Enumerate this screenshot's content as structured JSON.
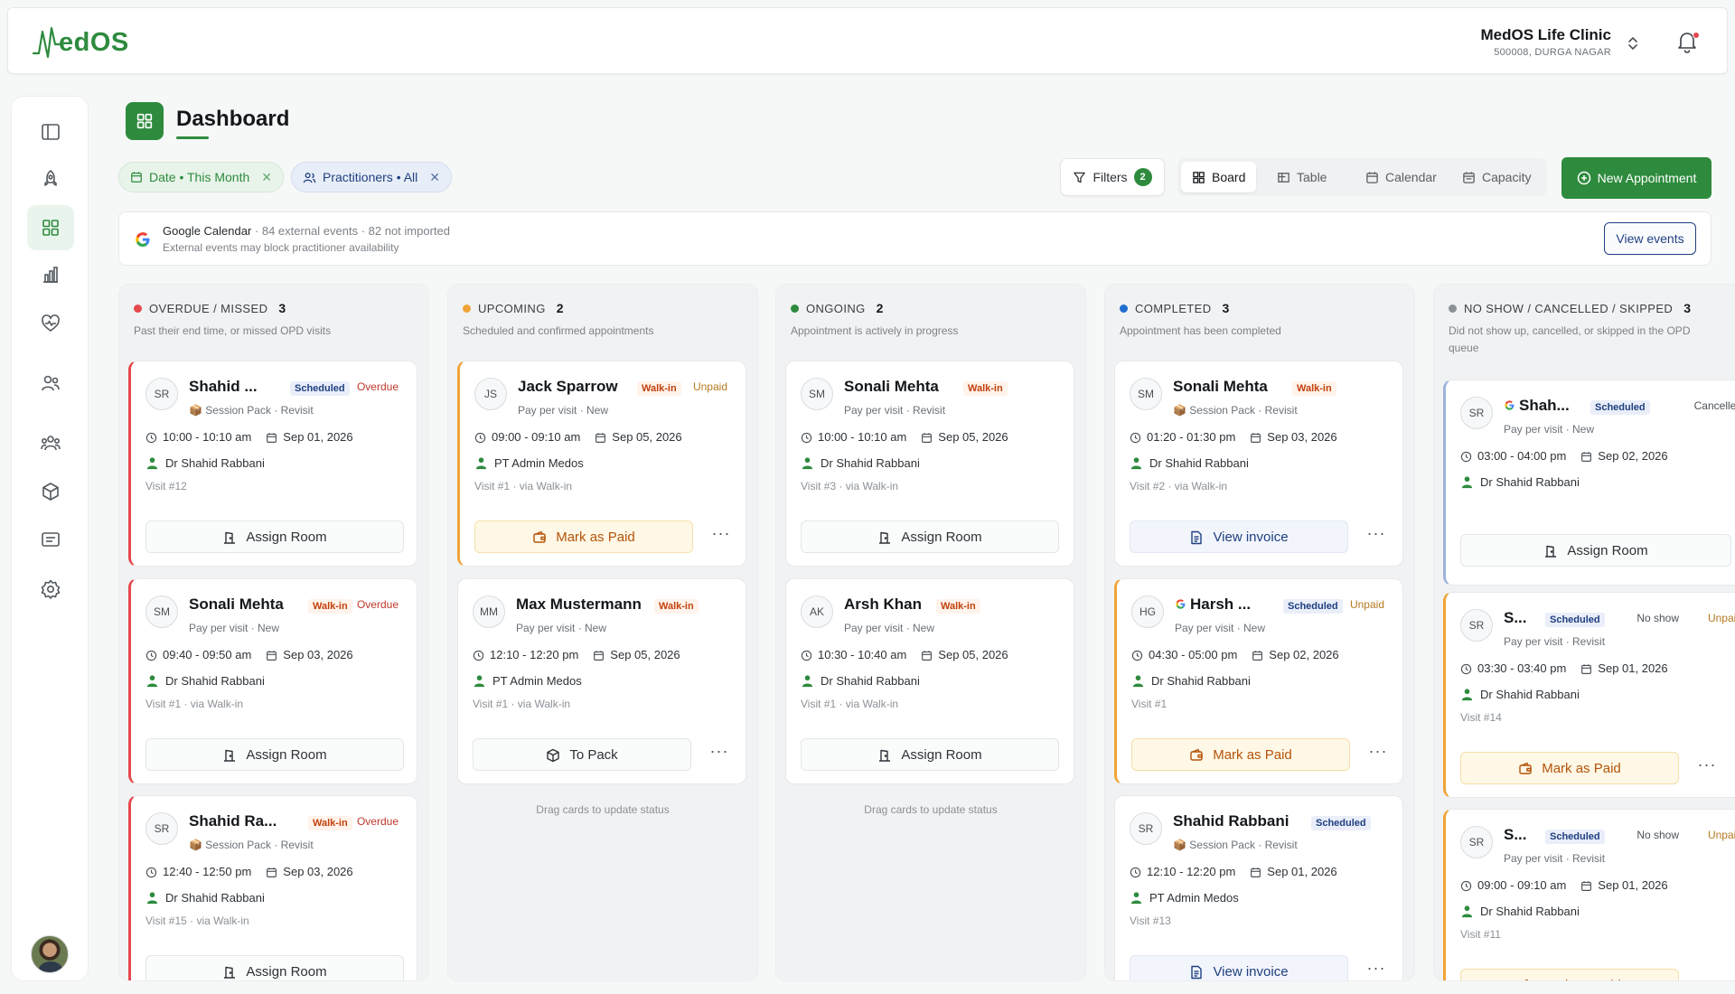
{
  "brand": {
    "logo_text": "edOS",
    "accent": "#2e8b3e"
  },
  "clinic": {
    "name": "MedOS Life Clinic",
    "address": "500008, DURGA NAGAR"
  },
  "page": {
    "title": "Dashboard"
  },
  "filter_chips": [
    {
      "label": "Date • This Month"
    },
    {
      "label": "Practitioners • All"
    }
  ],
  "toolbar": {
    "filters_label": "Filters",
    "filters_count": "2",
    "views": [
      "Board",
      "Table",
      "Calendar",
      "Capacity"
    ],
    "active_view": "Board",
    "new_appointment": "New Appointment"
  },
  "gcal": {
    "title": "Google Calendar",
    "meta": " · 84 external events · 82 not imported",
    "subtitle": "External events may block practitioner availability",
    "button": "View events"
  },
  "columns": [
    {
      "title": "OVERDUE / MISSED",
      "count": "3",
      "color": "#e5484d",
      "subtitle": "Past their end time, or missed OPD visits",
      "hint": "",
      "cards": [
        {
          "initials": "SR",
          "name": "Shahid ...",
          "tag": "Scheduled",
          "tag_type": "scheduled",
          "status": "Overdue",
          "status_type": "overdue",
          "pkg": "📦 Session Pack · Revisit",
          "time": "10:00 - 10:10 am",
          "date": "Sep 01, 2026",
          "doctor": "Dr Shahid Rabbani",
          "visit": "Visit #12",
          "action": "Assign Room",
          "action_type": "room",
          "more": false
        },
        {
          "initials": "SM",
          "name": "Sonali Mehta",
          "tag": "Walk-in",
          "tag_type": "walkin",
          "status": "Overdue",
          "status_type": "overdue",
          "pkg": "Pay per visit · New",
          "time": "09:40 - 09:50 am",
          "date": "Sep 03, 2026",
          "doctor": "Dr Shahid Rabbani",
          "visit": "Visit #1 · via Walk-in",
          "action": "Assign Room",
          "action_type": "room",
          "more": false
        },
        {
          "initials": "SR",
          "name": "Shahid Ra...",
          "tag": "Walk-in",
          "tag_type": "walkin",
          "status": "Overdue",
          "status_type": "overdue",
          "pkg": "📦 Session Pack · Revisit",
          "time": "12:40 - 12:50 pm",
          "date": "Sep 03, 2026",
          "doctor": "Dr Shahid Rabbani",
          "visit": "Visit #15 · via Walk-in",
          "action": "Assign Room",
          "action_type": "room",
          "more": false
        }
      ]
    },
    {
      "title": "UPCOMING",
      "count": "2",
      "color": "#f0a437",
      "subtitle": "Scheduled and confirmed appointments",
      "hint": "Drag cards to update status",
      "cards": [
        {
          "initials": "JS",
          "name": "Jack Sparrow",
          "tag": "Walk-in",
          "tag_type": "walkin",
          "status": "Unpaid",
          "status_type": "unpaid",
          "pkg": "Pay per visit · New",
          "time": "09:00 - 09:10 am",
          "date": "Sep 05, 2026",
          "doctor": "PT Admin Medos",
          "visit": "Visit #1 · via Walk-in",
          "action": "Mark as Paid",
          "action_type": "paid",
          "more": true
        },
        {
          "initials": "MM",
          "name": "Max Mustermann",
          "tag": "Walk-in",
          "tag_type": "walkin",
          "status": "",
          "status_type": "",
          "pkg": "Pay per visit · New",
          "time": "12:10 - 12:20 pm",
          "date": "Sep 05, 2026",
          "doctor": "PT Admin Medos",
          "visit": "Visit #1 · via Walk-in",
          "action": "To Pack",
          "action_type": "pack",
          "more": true
        }
      ]
    },
    {
      "title": "ONGOING",
      "count": "2",
      "color": "#2e8b3e",
      "subtitle": "Appointment is actively in progress",
      "hint": "Drag cards to update status",
      "cards": [
        {
          "initials": "SM",
          "name": "Sonali Mehta",
          "tag": "Walk-in",
          "tag_type": "walkin",
          "status": "",
          "status_type": "",
          "pkg": "Pay per visit · Revisit",
          "time": "10:00 - 10:10 am",
          "date": "Sep 05, 2026",
          "doctor": "Dr Shahid Rabbani",
          "visit": "Visit #3 · via Walk-in",
          "action": "Assign Room",
          "action_type": "room",
          "more": false
        },
        {
          "initials": "AK",
          "name": "Arsh Khan",
          "tag": "Walk-in",
          "tag_type": "walkin",
          "status": "",
          "status_type": "",
          "pkg": "Pay per visit · New",
          "time": "10:30 - 10:40 am",
          "date": "Sep 05, 2026",
          "doctor": "Dr Shahid Rabbani",
          "visit": "Visit #1 · via Walk-in",
          "action": "Assign Room",
          "action_type": "room",
          "more": false
        }
      ]
    },
    {
      "title": "COMPLETED",
      "count": "3",
      "color": "#1f6fd1",
      "subtitle": "Appointment has been completed",
      "hint": "",
      "cards": [
        {
          "initials": "SM",
          "name": "Sonali Mehta",
          "tag": "Walk-in",
          "tag_type": "walkin",
          "status": "",
          "status_type": "",
          "pkg": "📦 Session Pack · Revisit",
          "time": "01:20 - 01:30 pm",
          "date": "Sep 03, 2026",
          "doctor": "Dr Shahid Rabbani",
          "visit": "Visit #2 · via Walk-in",
          "action": "View invoice",
          "action_type": "invoice",
          "more": true
        },
        {
          "initials": "HG",
          "name": "Harsh ...",
          "google": true,
          "tag": "Scheduled",
          "tag_type": "scheduled",
          "status": "Unpaid",
          "status_type": "unpaid",
          "pkg": "Pay per visit · New",
          "time": "04:30 - 05:00 pm",
          "date": "Sep 02, 2026",
          "doctor": "Dr Shahid Rabbani",
          "visit": "Visit #1",
          "action": "Mark as Paid",
          "action_type": "paid",
          "more": true
        },
        {
          "initials": "SR",
          "name": "Shahid Rabbani",
          "tag": "Scheduled",
          "tag_type": "scheduled",
          "status": "",
          "status_type": "",
          "pkg": "📦 Session Pack · Revisit",
          "time": "12:10 - 12:20 pm",
          "date": "Sep 01, 2026",
          "doctor": "PT Admin Medos",
          "visit": "Visit #13",
          "action": "View invoice",
          "action_type": "invoice",
          "more": true
        }
      ]
    },
    {
      "title": "NO SHOW / CANCELLED / SKIPPED",
      "count": "3",
      "color": "#8b9197",
      "subtitle": "Did not show up, cancelled, or skipped in the OPD queue",
      "hint": "",
      "cards": [
        {
          "initials": "SR",
          "name": "Shah...",
          "google": true,
          "tag": "Scheduled",
          "tag_type": "scheduled",
          "status": "Cancelled",
          "status_type": "cancelled",
          "pkg": "Pay per visit · New",
          "time": "03:00 - 04:00 pm",
          "date": "Sep 02, 2026",
          "doctor": "Dr Shahid Rabbani",
          "visit": "",
          "action": "Assign Room",
          "action_type": "room",
          "more": false
        },
        {
          "initials": "SR",
          "name": "S...",
          "tag": "Scheduled",
          "tag_type": "scheduled",
          "status": "No show",
          "status_type": "noshow",
          "status2": "Unpaid",
          "pkg": "Pay per visit · Revisit",
          "time": "03:30 - 03:40 pm",
          "date": "Sep 01, 2026",
          "doctor": "Dr Shahid Rabbani",
          "visit": "Visit #14",
          "action": "Mark as Paid",
          "action_type": "paid",
          "more": true
        },
        {
          "initials": "SR",
          "name": "S...",
          "tag": "Scheduled",
          "tag_type": "scheduled",
          "status": "No show",
          "status_type": "noshow",
          "status2": "Unpaid",
          "pkg": "Pay per visit · Revisit",
          "time": "09:00 - 09:10 am",
          "date": "Sep 01, 2026",
          "doctor": "Dr Shahid Rabbani",
          "visit": "Visit #11",
          "action": "Mark as Paid",
          "action_type": "paid",
          "more": true
        }
      ]
    }
  ],
  "sidebar": {
    "items": [
      "panel-toggle-icon",
      "rocket-icon",
      "dashboard-icon",
      "bar-chart-icon",
      "heart-pulse-icon",
      "users-icon",
      "team-icon",
      "package-icon",
      "messages-icon",
      "settings-icon"
    ],
    "active": "dashboard-icon"
  }
}
